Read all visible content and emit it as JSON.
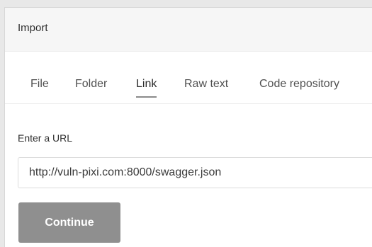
{
  "dialog": {
    "title": "Import",
    "tabs": [
      {
        "label": "File"
      },
      {
        "label": "Folder"
      },
      {
        "label": "Link"
      },
      {
        "label": "Raw text"
      },
      {
        "label": "Code repository"
      }
    ],
    "active_tab": "Link",
    "url_section": {
      "label": "Enter a URL",
      "value": "http://vuln-pixi.com:8000/swagger.json"
    },
    "continue_label": "Continue"
  },
  "colors": {
    "header_bg": "#f6f6f6",
    "button_bg": "#8f8f8f",
    "active_tab_underline": "#8a8a8a"
  }
}
